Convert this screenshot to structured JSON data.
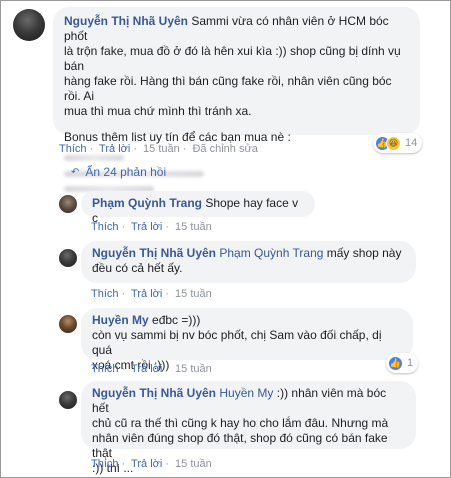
{
  "comments": {
    "main": {
      "author": "Nguyễn Thị Nhã Uyên",
      "text_line1": "Sammi vừa có nhân viên ở HCM bóc phốt",
      "text_line2": "là trộn fake, mua đồ ở đó là hên xui kìa :)) shop cũng bị dính vụ bán",
      "text_line3": "hàng fake rồi. Hàng thì bán cũng fake rồi, nhân viên cũng bóc rồi. Ai",
      "text_line4": "mua thì mua chứ mình thì tránh xa.",
      "text_line5": "Bonus thêm list uy tín để các bạn mua nè :",
      "like": "Thích",
      "reply": "Trả lời",
      "time": "15 tuần",
      "edited": "Đã chỉnh sửa",
      "reaction_count": "14"
    },
    "replies_toggle": "Ẩn 24 phản hồi",
    "reply1": {
      "author": "Phạm Quỳnh Trang",
      "text": "Shope hay face v c",
      "like": "Thích",
      "reply": "Trả lời",
      "time": "15 tuần"
    },
    "reply2": {
      "author": "Nguyễn Thị Nhã Uyên",
      "mention": "Phạm Quỳnh Trang",
      "text_line1": "mấy shop này",
      "text_line2": "đều có cả hết ấy.",
      "like": "Thích",
      "reply": "Trả lời",
      "time": "15 tuần"
    },
    "reply3": {
      "author": "Huyền My",
      "text_line1": "eđbc =)))",
      "text_line2": "còn vụ sammi bị nv bóc phốt, chị Sam vào đối chấp, dị quá",
      "text_line3": "xoá cmt rồi :)))",
      "like": "Thích",
      "reply": "Trả lời",
      "time": "15 tuần",
      "reaction_count": "1"
    },
    "reply4": {
      "author": "Nguyễn Thị Nhã Uyên",
      "mention": "Huyền My",
      "text_line1": ":)) nhân viên mà bóc hết",
      "text_line2": "chủ cũ ra thế thì cũng k hay ho cho lắm đâu. Nhưng mà",
      "text_line3": "nhân viên đúng shop đó thật, shop đó cũng có bán fake thật",
      "text_line4": ":)) thì ...",
      "like": "Thích",
      "reply": "Trả lời",
      "time": "15 tuần"
    }
  }
}
